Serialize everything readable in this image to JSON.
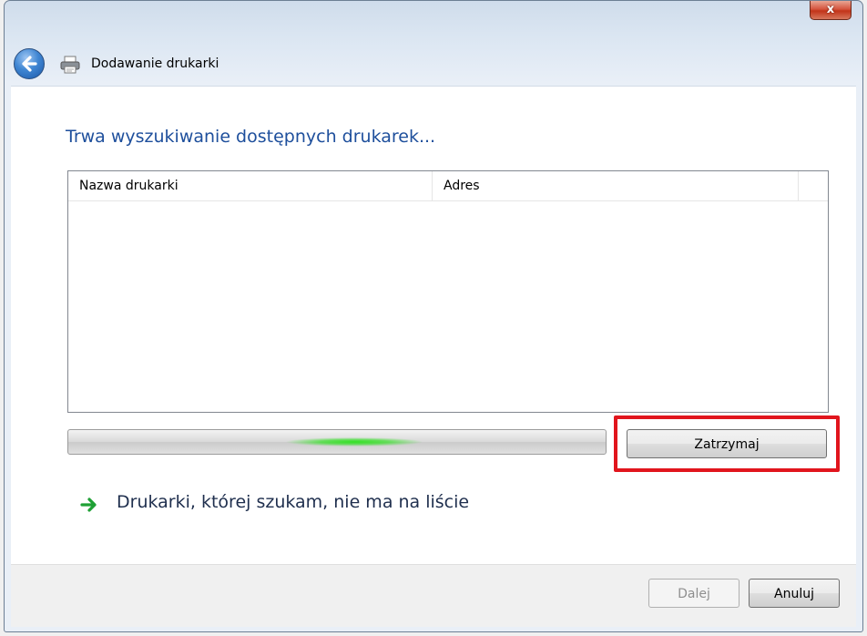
{
  "window": {
    "title": "Dodawanie drukarki",
    "close_label": "x"
  },
  "main": {
    "heading": "Trwa wyszukiwanie dostępnych drukarek...",
    "columns": [
      "Nazwa drukarki",
      "Adres"
    ],
    "rows": [],
    "stop_label": "Zatrzymaj",
    "missing_link": "Drukarki, której szukam, nie ma na liście"
  },
  "footer": {
    "next_label": "Dalej",
    "cancel_label": "Anuluj"
  },
  "colors": {
    "heading": "#1e4f9c",
    "highlight": "#e1151d",
    "progress_glow": "#33e024",
    "link_arrow": "#1fa035"
  },
  "icons": {
    "back": "back-arrow-icon",
    "printer": "printer-icon",
    "link": "green-arrow-icon"
  }
}
